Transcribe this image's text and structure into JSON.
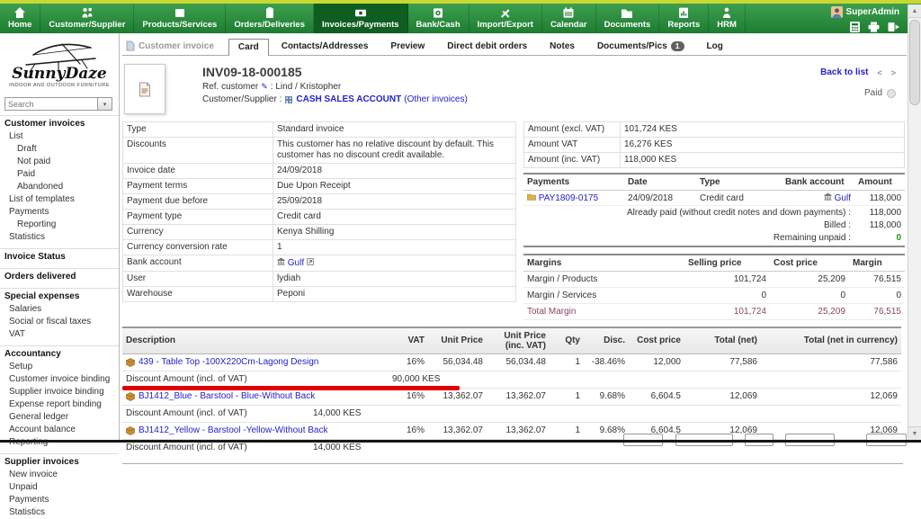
{
  "topbar": {
    "user_name": "SuperAdmin",
    "menus": [
      {
        "label": "Home"
      },
      {
        "label": "Customer/Supplier"
      },
      {
        "label": "Products/Services"
      },
      {
        "label": "Orders/Deliveries"
      },
      {
        "label": "Invoices/Payments"
      },
      {
        "label": "Bank/Cash"
      },
      {
        "label": "Import/Export"
      },
      {
        "label": "Calendar"
      },
      {
        "label": "Documents"
      },
      {
        "label": "Reports"
      },
      {
        "label": "HRM"
      }
    ]
  },
  "sidebar": {
    "brand": "SunnyDaze",
    "tagline": "INDOOR AND OUTDOOR FURNITURE",
    "search_placeholder": "Search",
    "sections": [
      {
        "heading": "Customer invoices",
        "items": [
          {
            "label": "List"
          },
          {
            "label": "Draft"
          },
          {
            "label": "Not paid"
          },
          {
            "label": "Paid"
          },
          {
            "label": "Abandoned"
          },
          {
            "label": "List of templates"
          },
          {
            "label": "Payments"
          },
          {
            "label": "Reporting"
          },
          {
            "label": "Statistics"
          }
        ]
      },
      {
        "heading": "Invoice Status",
        "items": []
      },
      {
        "heading": "Orders delivered",
        "items": []
      },
      {
        "heading": "Special expenses",
        "items": [
          {
            "label": "Salaries"
          },
          {
            "label": "Social or fiscal taxes"
          },
          {
            "label": "VAT"
          }
        ]
      },
      {
        "heading": "Accountancy",
        "items": [
          {
            "label": "Setup"
          },
          {
            "label": "Customer invoice binding"
          },
          {
            "label": "Supplier invoice binding"
          },
          {
            "label": "Expense report binding"
          },
          {
            "label": "General ledger"
          },
          {
            "label": "Account balance"
          },
          {
            "label": "Reporting"
          }
        ]
      },
      {
        "heading": "Supplier invoices",
        "items": [
          {
            "label": "New invoice"
          },
          {
            "label": "Unpaid"
          },
          {
            "label": "Payments"
          },
          {
            "label": "Statistics"
          }
        ]
      }
    ]
  },
  "tabs": {
    "context": "Customer invoice",
    "items": [
      {
        "label": "Card"
      },
      {
        "label": "Contacts/Addresses"
      },
      {
        "label": "Preview"
      },
      {
        "label": "Direct debit orders"
      },
      {
        "label": "Notes"
      },
      {
        "label": "Documents/Pics",
        "badge": "1"
      },
      {
        "label": "Log"
      }
    ]
  },
  "header": {
    "ref": "INV09-18-000185",
    "ref_customer_label": "Ref. customer",
    "ref_customer_value": ": Lind / Kristopher",
    "customer_label": "Customer/Supplier :",
    "customer_link": "CASH SALES ACCOUNT",
    "other_invoices": "(Other invoices)",
    "back_to_list": "Back to list",
    "pager_prev": "<",
    "pager_next": ">",
    "status": "Paid"
  },
  "details": {
    "rows": [
      {
        "label": "Type",
        "value": "Standard invoice"
      },
      {
        "label": "Discounts",
        "value": "This customer has no relative discount by default. This customer has no discount credit available."
      },
      {
        "label": "Invoice date",
        "value": "24/09/2018"
      },
      {
        "label": "Payment terms",
        "value": "Due Upon Receipt"
      },
      {
        "label": "Payment due before",
        "value": "25/09/2018"
      },
      {
        "label": "Payment type",
        "value": "Credit card"
      },
      {
        "label": "Currency",
        "value": "Kenya Shilling"
      },
      {
        "label": "Currency conversion rate",
        "value": "1"
      },
      {
        "label": "Bank account",
        "value": "Gulf"
      },
      {
        "label": "User",
        "value": "lydiah"
      },
      {
        "label": "Warehouse",
        "value": "Peponi"
      }
    ]
  },
  "amounts": {
    "rows": [
      {
        "label": "Amount (excl. VAT)",
        "value": "101,724 KES"
      },
      {
        "label": "Amount VAT",
        "value": "16,276 KES"
      },
      {
        "label": "Amount (inc. VAT)",
        "value": "118,000 KES"
      }
    ]
  },
  "payments": {
    "headers": [
      "Payments",
      "Date",
      "Type",
      "Bank account",
      "Amount"
    ],
    "row": {
      "ref": "PAY1809-0175",
      "date": "24/09/2018",
      "type": "Credit card",
      "bank": "Gulf",
      "amount": "118,000"
    },
    "summary": [
      {
        "label": "Already paid (without credit notes and down payments) :",
        "value": "118,000"
      },
      {
        "label": "Billed :",
        "value": "118,000"
      },
      {
        "label": "Remaining unpaid :",
        "value": "0"
      }
    ]
  },
  "margins": {
    "headers": [
      "Margins",
      "Selling price",
      "Cost price",
      "Margin"
    ],
    "rows": [
      {
        "label": "Margin / Products",
        "selling": "101,724",
        "cost": "25,209",
        "margin": "76,515"
      },
      {
        "label": "Margin / Services",
        "selling": "0",
        "cost": "0",
        "margin": "0"
      },
      {
        "label": "Total Margin",
        "selling": "101,724",
        "cost": "25,209",
        "margin": "76,515"
      }
    ]
  },
  "lines": {
    "headers": [
      "Description",
      "VAT",
      "Unit Price",
      "Unit Price (inc. VAT)",
      "Qty",
      "Disc.",
      "Cost price",
      "Total (net)",
      "Total (net in currency)"
    ],
    "rows": [
      {
        "desc": "439 - Table Top -100X220Cm-Lagong Design",
        "vat": "16%",
        "unit": "56,034.48",
        "unit_inc": "56,034.48",
        "qty": "1",
        "disc": "-38.46%",
        "cost": "12,000",
        "total": "77,586",
        "total_cur": "77,586",
        "discount_label": "Discount Amount (incl. of VAT)",
        "discount_amount": "90,000 KES"
      },
      {
        "desc": "BJ1412_Blue - Barstool - Blue-Without Back",
        "vat": "16%",
        "unit": "13,362.07",
        "unit_inc": "13,362.07",
        "qty": "1",
        "disc": "9.68%",
        "cost": "6,604.5",
        "total": "12,069",
        "total_cur": "12,069",
        "discount_label": "Discount Amount (incl. of VAT)",
        "discount_amount": "14,000 KES"
      },
      {
        "desc": "BJ1412_Yellow - Barstool -Yellow-Without Back",
        "vat": "16%",
        "unit": "13,362.07",
        "unit_inc": "13,362.07",
        "qty": "1",
        "disc": "9.68%",
        "cost": "6,604.5",
        "total": "12,069",
        "total_cur": "12,069",
        "discount_label": "Discount Amount (incl. of VAT)",
        "discount_amount": "14,000 KES"
      }
    ]
  },
  "colors": {
    "menu_green": "#1d7c31",
    "lime_bar": "#c8d831",
    "link_blue": "#2222cc",
    "annotation_red": "#e00000",
    "remaining_unpaid_green": "#1a9b1a",
    "total_margin_purple": "#884466"
  }
}
